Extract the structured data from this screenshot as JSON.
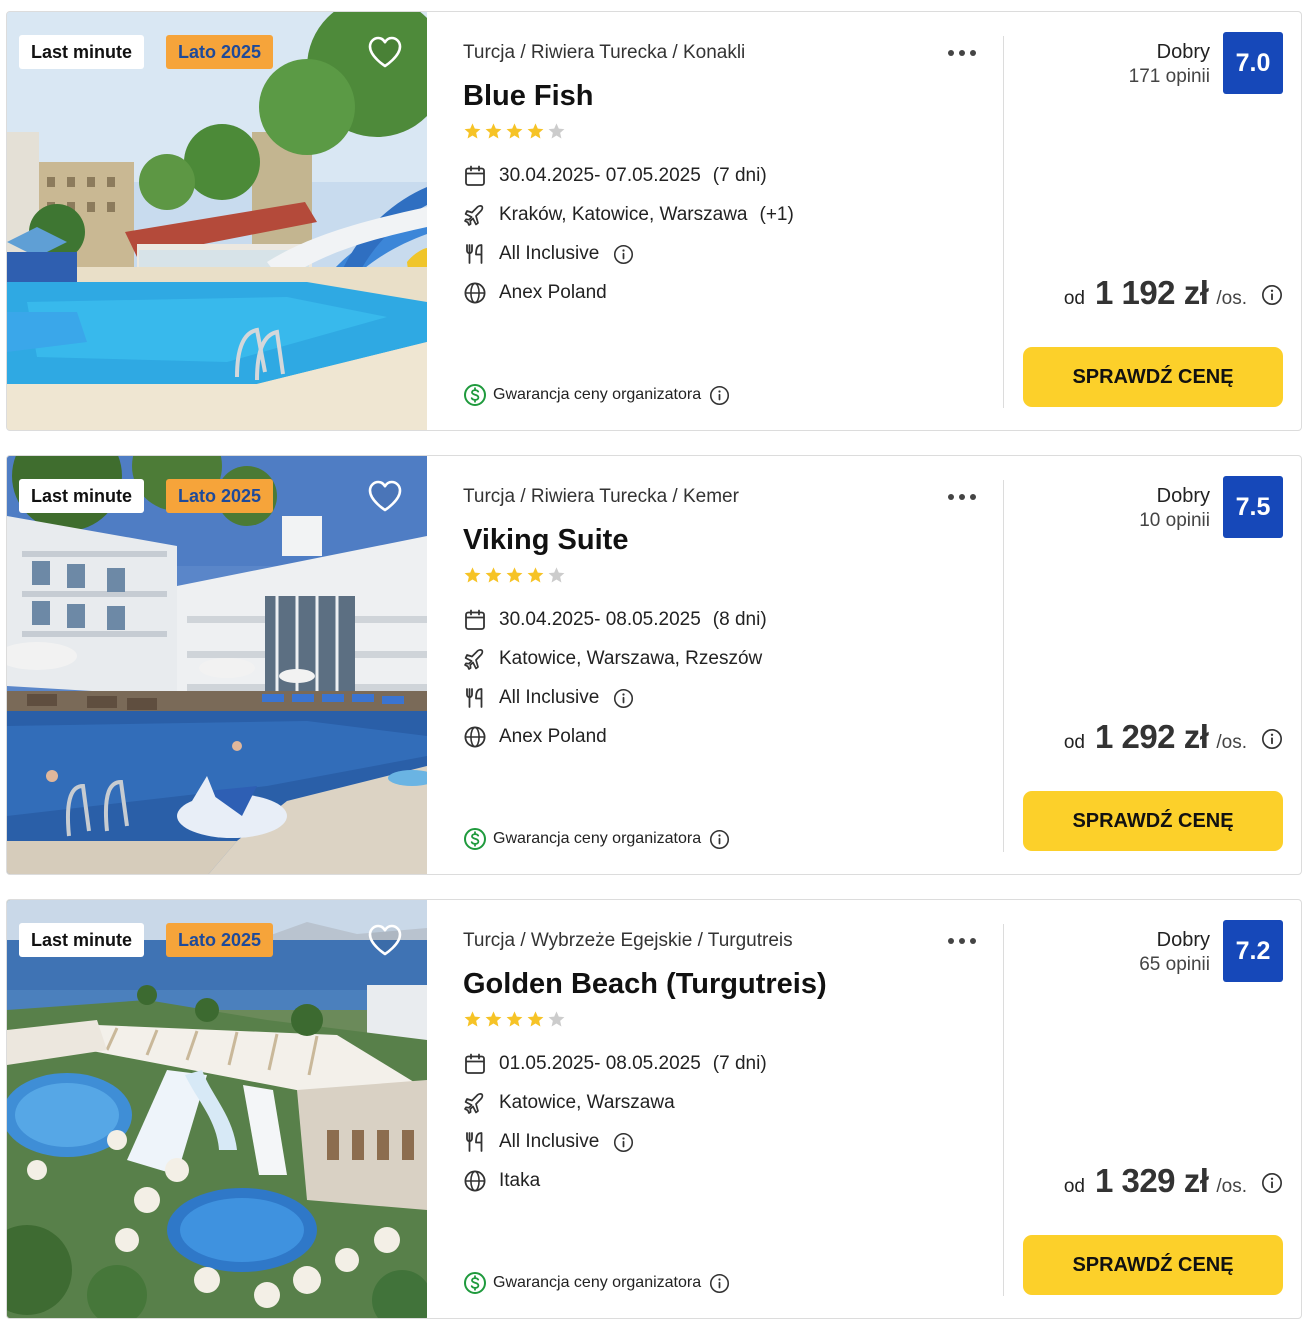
{
  "offers": [
    {
      "badges": {
        "last_minute": "Last minute",
        "season": "Lato 2025"
      },
      "breadcrumb": "Turcja / Riwiera Turecka / Konakli",
      "name": "Blue Fish",
      "stars_filled": 4,
      "stars_total": 5,
      "dates": "30.04.2025- 07.05.2025",
      "duration": "(7 dni)",
      "departure": "Kraków, Katowice, Warszawa",
      "departure_more": "(+1)",
      "board": "All Inclusive",
      "operator": "Anex Poland",
      "guarantee": "Gwarancja ceny organizatora",
      "rating_label": "Dobry",
      "rating_count": "171 opinii",
      "rating_score": "7.0",
      "price_from": "od",
      "price": "1 192 zł",
      "price_unit": "/os.",
      "cta": "SPRAWDŹ CENĘ"
    },
    {
      "badges": {
        "last_minute": "Last minute",
        "season": "Lato 2025"
      },
      "breadcrumb": "Turcja / Riwiera Turecka / Kemer",
      "name": "Viking Suite",
      "stars_filled": 4,
      "stars_total": 5,
      "dates": "30.04.2025- 08.05.2025",
      "duration": "(8 dni)",
      "departure": "Katowice, Warszawa, Rzeszów",
      "departure_more": "",
      "board": "All Inclusive",
      "operator": "Anex Poland",
      "guarantee": "Gwarancja ceny organizatora",
      "rating_label": "Dobry",
      "rating_count": "10 opinii",
      "rating_score": "7.5",
      "price_from": "od",
      "price": "1 292 zł",
      "price_unit": "/os.",
      "cta": "SPRAWDŹ CENĘ"
    },
    {
      "badges": {
        "last_minute": "Last minute",
        "season": "Lato 2025"
      },
      "breadcrumb": "Turcja / Wybrzeże Egejskie / Turgutreis",
      "name": "Golden Beach (Turgutreis)",
      "stars_filled": 4,
      "stars_total": 5,
      "dates": "01.05.2025- 08.05.2025",
      "duration": "(7 dni)",
      "departure": "Katowice, Warszawa",
      "departure_more": "",
      "board": "All Inclusive",
      "operator": "Itaka",
      "guarantee": "Gwarancja ceny organizatora",
      "rating_label": "Dobry",
      "rating_count": "65 opinii",
      "rating_score": "7.2",
      "price_from": "od",
      "price": "1 329 zł",
      "price_unit": "/os.",
      "cta": "SPRAWDŹ CENĘ"
    }
  ],
  "icons": {
    "favorite": "heart-outline-icon",
    "more": "more-dots-icon",
    "dates": "calendar-icon",
    "departure": "plane-icon",
    "board": "utensils-icon",
    "operator": "globe-icon",
    "guarantee": "dollar-circle-icon",
    "info": "info-icon",
    "star": "star-icon"
  },
  "colors": {
    "cta": "#fcd02a",
    "score": "#1648b9",
    "season_badge": "#f6a43a",
    "season_badge_text": "#1e4a9a",
    "star": "#f6c326",
    "star_empty": "#cccccc",
    "guarantee": "#1f9a3d"
  }
}
